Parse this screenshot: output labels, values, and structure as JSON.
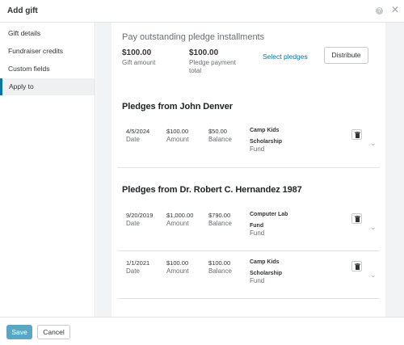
{
  "header": {
    "title": "Add gift",
    "help_icon": "question-circle-icon",
    "close_icon": "close-icon"
  },
  "sidebar": {
    "items": [
      {
        "label": "Gift details",
        "active": false
      },
      {
        "label": "Fundraiser credits",
        "active": false
      },
      {
        "label": "Custom fields",
        "active": false
      },
      {
        "label": "Apply to",
        "active": true
      }
    ]
  },
  "apply": {
    "section_title": "Pay outstanding pledge installments",
    "gift_amount": "$100.00",
    "gift_amount_label": "Gift amount",
    "payment_total": "$100.00",
    "payment_total_label_1": "Pledge payment",
    "payment_total_label_2": "total",
    "select_pledges": "Select pledges",
    "distribute": "Distribute"
  },
  "labels": {
    "date": "Date",
    "amount": "Amount",
    "balance": "Balance",
    "fund": "Fund"
  },
  "groups": [
    {
      "title": "Pledges from John Denver",
      "pledges": [
        {
          "date": "4/5/2024",
          "amount": "$100.00",
          "balance": "$50.00",
          "fund_1": "Camp Kids",
          "fund_2": "Scholarship"
        }
      ]
    },
    {
      "title": "Pledges from Dr. Robert C. Hernandez 1987",
      "pledges": [
        {
          "date": "9/20/2019",
          "amount": "$1,000.00",
          "balance": "$790.00",
          "fund_1": "Computer Lab",
          "fund_2": "Fund"
        },
        {
          "date": "1/1/2021",
          "amount": "$100.00",
          "balance": "$100.00",
          "fund_1": "Camp Kids",
          "fund_2": "Scholarship"
        }
      ]
    }
  ],
  "footer": {
    "save": "Save",
    "cancel": "Cancel"
  },
  "colors": {
    "accent": "#0974a1",
    "save_button": "#5aa6c7",
    "page_bg": "#f2f3f4"
  }
}
